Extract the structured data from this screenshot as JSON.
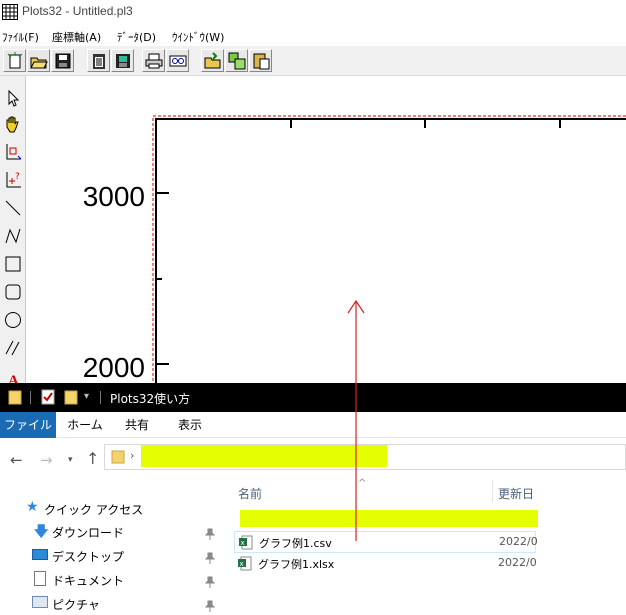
{
  "plots_window": {
    "title": "Plots32 - Untitled.pl3",
    "menu": [
      "ﾌｧｲﾙ(F)",
      "座標軸(A)",
      "ﾃﾞｰﾀ(D)",
      "ｳｲﾝﾄﾞｳ(W)"
    ],
    "toolbar_icons": [
      "new-icon",
      "open-icon",
      "save-icon",
      "clipboard-icon",
      "save-image-icon",
      "print-icon",
      "preview-icon",
      "open-folder-icon",
      "copy-icon",
      "paste-icon"
    ],
    "tools": [
      "pointer-tool-icon",
      "hand-tool-icon",
      "axis-select-tool-icon",
      "point-query-tool-icon",
      "line-tool-icon",
      "polyline-tool-icon",
      "rectangle-tool-icon",
      "rounded-rectangle-tool-icon",
      "ellipse-tool-icon",
      "parallel-lines-tool-icon",
      "text-tool-icon"
    ],
    "y_tick_labels": [
      "3000",
      "2000"
    ]
  },
  "explorer_window": {
    "title": "Plots32使い方",
    "ribbon_tabs": [
      "ファイル",
      "ホーム",
      "共有",
      "表示"
    ],
    "active_tab": "ファイル",
    "nav_items": [
      "クイック アクセス",
      "ダウンロード",
      "デスクトップ",
      "ドキュメント",
      "ピクチャ"
    ],
    "columns": {
      "name": "名前",
      "modified": "更新日"
    },
    "files": [
      {
        "name": "グラフ例1.csv",
        "date": "2022/0"
      },
      {
        "name": "グラフ例1.xlsx",
        "date": "2022/0"
      }
    ],
    "highlight_color": "#e6ff00",
    "accent_color": "#1a6bb3"
  }
}
